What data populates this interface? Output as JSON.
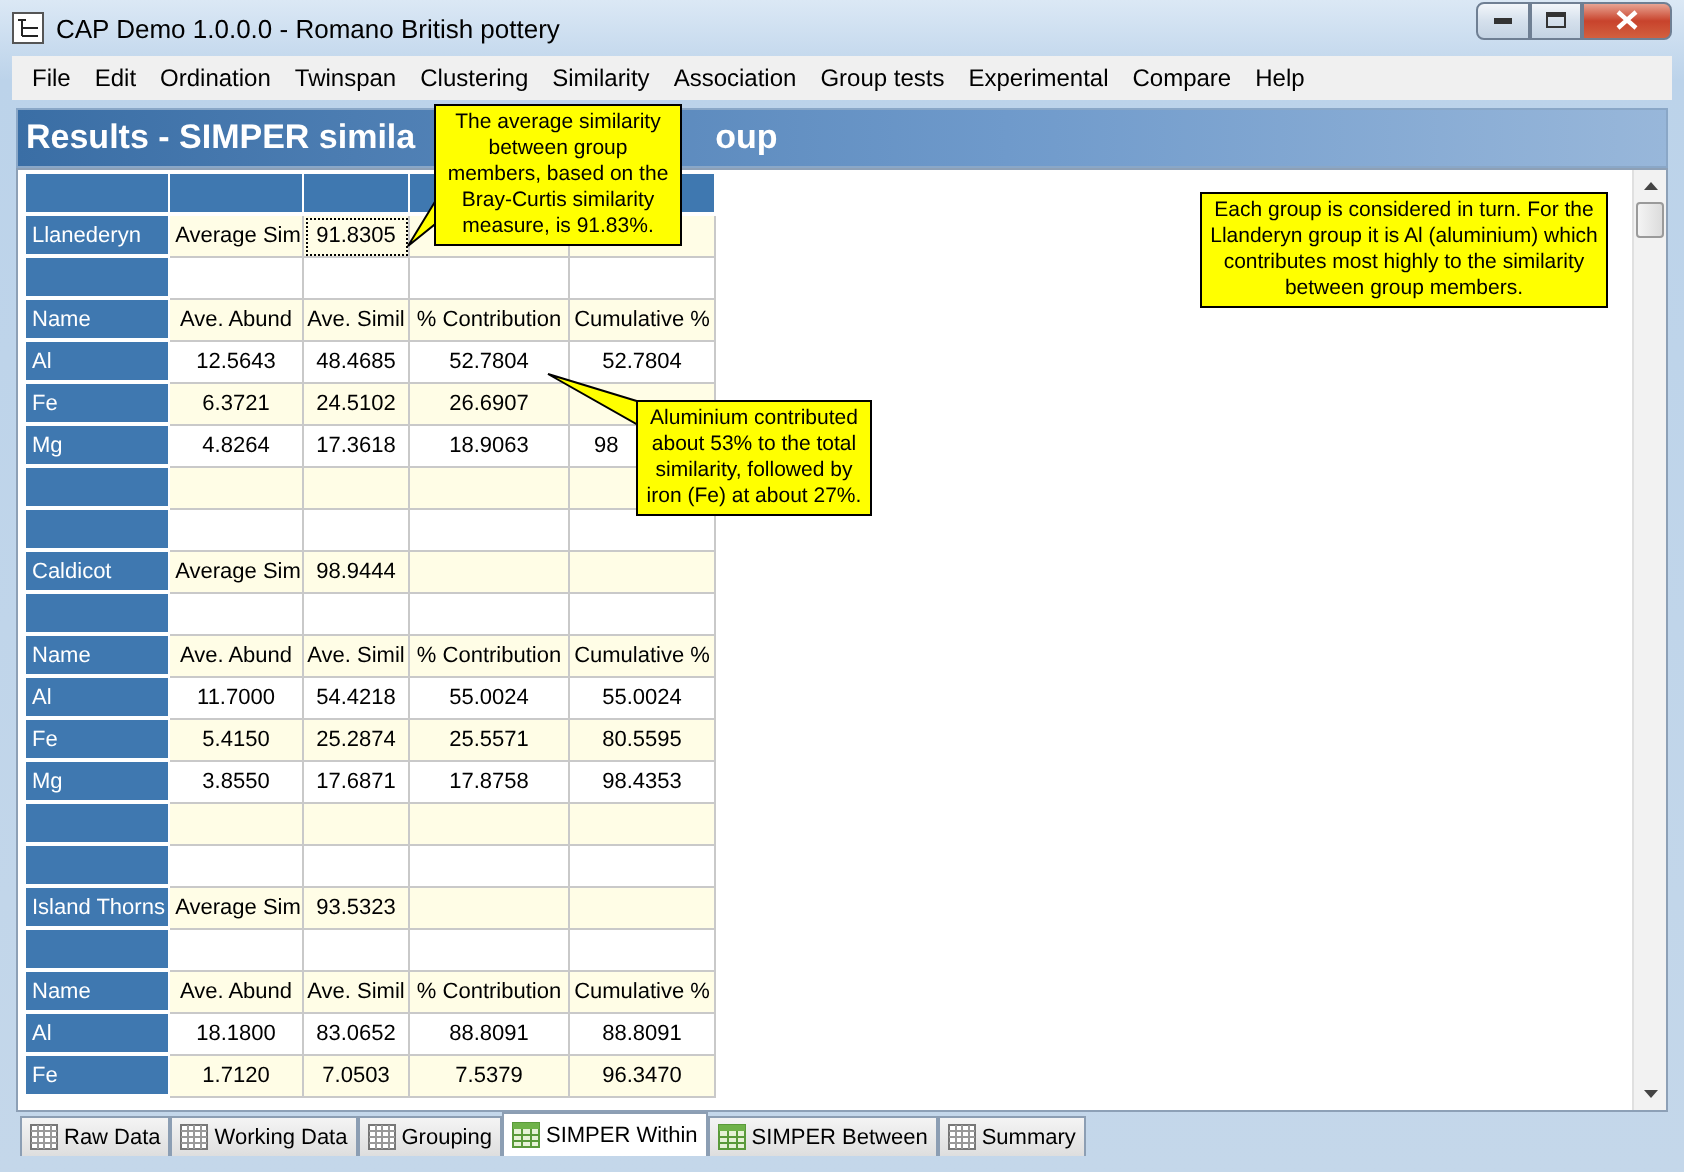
{
  "window": {
    "title": "CAP Demo 1.0.0.0 - Romano British pottery"
  },
  "menu": [
    {
      "label": "File"
    },
    {
      "label": "Edit"
    },
    {
      "label": "Ordination"
    },
    {
      "label": "Twinspan"
    },
    {
      "label": "Clustering"
    },
    {
      "label": "Similarity"
    },
    {
      "label": "Association"
    },
    {
      "label": "Group tests"
    },
    {
      "label": "Experimental"
    },
    {
      "label": "Compare"
    },
    {
      "label": "Help"
    }
  ],
  "heading": {
    "visible_start": "Results - SIMPER simila",
    "visible_end": "oup"
  },
  "table": {
    "rows": [
      {
        "kind": "blank"
      },
      {
        "kind": "group",
        "name": "Llanederyn",
        "label": "Average Sim",
        "value": "91.8305",
        "selected": true
      },
      {
        "kind": "blank"
      },
      {
        "kind": "header",
        "name": "Name",
        "cells": [
          "Ave. Abund",
          "Ave. Simil",
          "% Contribution",
          "Cumulative %"
        ]
      },
      {
        "kind": "data",
        "name": "Al",
        "cells": [
          "12.5643",
          "48.4685",
          "52.7804",
          "52.7804"
        ]
      },
      {
        "kind": "data",
        "name": "Fe",
        "cells": [
          "6.3721",
          "24.5102",
          "26.6907",
          null
        ]
      },
      {
        "kind": "data",
        "name": "Mg",
        "cells": [
          "4.8264",
          "17.3618",
          "18.9063",
          "98"
        ]
      },
      {
        "kind": "blank"
      },
      {
        "kind": "blank"
      },
      {
        "kind": "group",
        "name": "Caldicot",
        "label": "Average Sim",
        "value": "98.9444",
        "selected": false
      },
      {
        "kind": "blank"
      },
      {
        "kind": "header",
        "name": "Name",
        "cells": [
          "Ave. Abund",
          "Ave. Simil",
          "% Contribution",
          "Cumulative %"
        ]
      },
      {
        "kind": "data",
        "name": "Al",
        "cells": [
          "11.7000",
          "54.4218",
          "55.0024",
          "55.0024"
        ]
      },
      {
        "kind": "data",
        "name": "Fe",
        "cells": [
          "5.4150",
          "25.2874",
          "25.5571",
          "80.5595"
        ]
      },
      {
        "kind": "data",
        "name": "Mg",
        "cells": [
          "3.8550",
          "17.6871",
          "17.8758",
          "98.4353"
        ]
      },
      {
        "kind": "blank"
      },
      {
        "kind": "blank"
      },
      {
        "kind": "group",
        "name": "Island Thorns",
        "label": "Average Sim",
        "value": "93.5323",
        "selected": false
      },
      {
        "kind": "blank"
      },
      {
        "kind": "header",
        "name": "Name",
        "cells": [
          "Ave. Abund",
          "Ave. Simil",
          "% Contribution",
          "Cumulative %"
        ]
      },
      {
        "kind": "data",
        "name": "Al",
        "cells": [
          "18.1800",
          "83.0652",
          "88.8091",
          "88.8091"
        ]
      },
      {
        "kind": "data",
        "name": "Fe",
        "cells": [
          "1.7120",
          "7.0503",
          "7.5379",
          "96.3470"
        ]
      }
    ]
  },
  "callouts": [
    {
      "text": "The average similarity between group members, based on the Bray-Curtis similarity measure, is 91.83%."
    },
    {
      "text": "Aluminium contributed about 53% to the total similarity, followed by iron (Fe) at about 27%."
    },
    {
      "text": "Each group is considered in turn. For the Llanderyn group it is Al (aluminium) which contributes most highly to the similarity between group members."
    }
  ],
  "tabs": [
    {
      "label": "Raw Data",
      "kind": "grid",
      "selected": false
    },
    {
      "label": "Working Data",
      "kind": "grid",
      "selected": false
    },
    {
      "label": "Grouping",
      "kind": "grid",
      "selected": false
    },
    {
      "label": "SIMPER Within",
      "kind": "sheet",
      "selected": true
    },
    {
      "label": "SIMPER Between",
      "kind": "sheet",
      "selected": false
    },
    {
      "label": "Summary",
      "kind": "grid",
      "selected": false
    }
  ]
}
